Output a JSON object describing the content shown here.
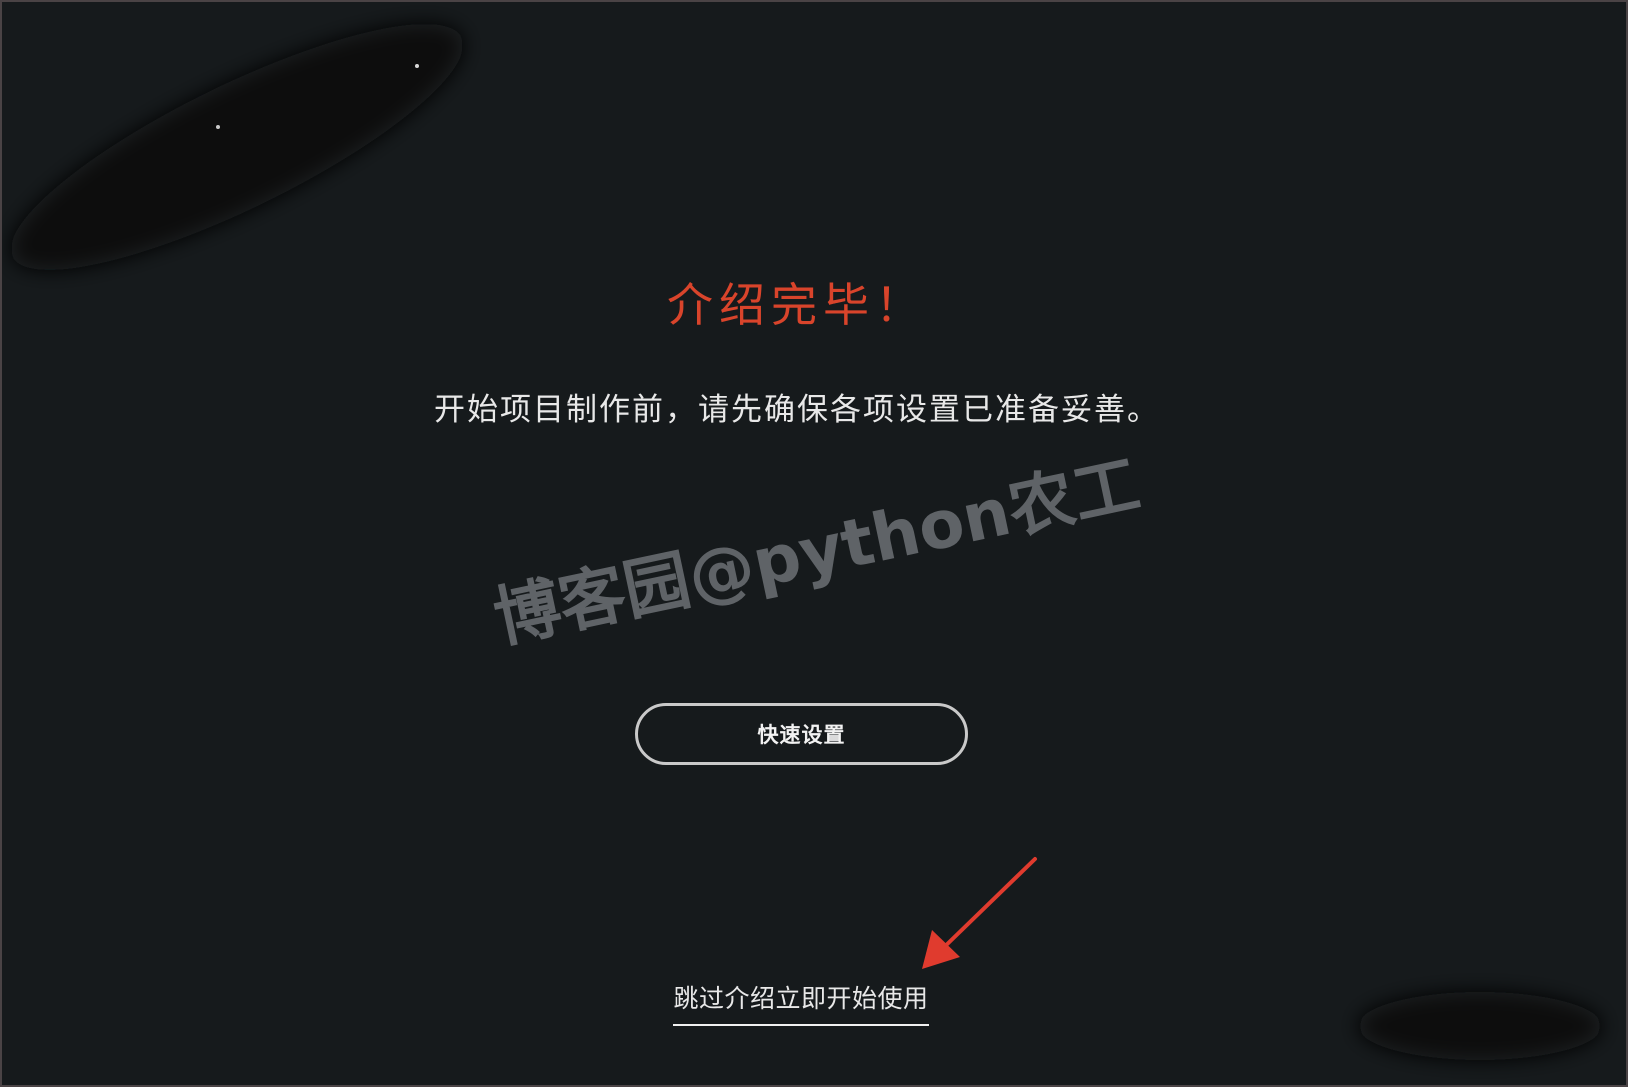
{
  "intro": {
    "title": "介绍完毕！",
    "message": "开始项目制作前，请先确保各项设置已准备妥善。"
  },
  "actions": {
    "quick_setup_label": "快速设置",
    "skip_link_label": "跳过介绍立即开始使用"
  },
  "watermark": {
    "text": "博客园@python农工"
  },
  "icons": {
    "annotation": "red-arrow-icon"
  },
  "colors": {
    "background": "#161a1c",
    "title": "#d9442b",
    "text": "#e8e8e8",
    "button_border": "#c9c9c9",
    "arrow": "#e03b2e"
  }
}
